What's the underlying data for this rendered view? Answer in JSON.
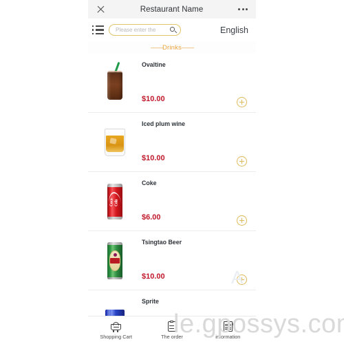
{
  "titlebar": {
    "close_icon": "close-icon",
    "title": "Restaurant Name",
    "more_icon": "more-options-icon"
  },
  "toolbar": {
    "menu_icon": "list-menu-icon",
    "search_placeholder": "Please enter the",
    "search_value": "",
    "search_icon": "search-icon",
    "language": "English"
  },
  "section": {
    "dash_left": "——",
    "label": "Drinks",
    "dash_right": "——",
    "accent_color": "#e8a33d"
  },
  "products": [
    {
      "name": "Ovaltine",
      "price": "$10.00",
      "art": "glass-tall",
      "add_label": "add-to-cart"
    },
    {
      "name": "Iced plum wine",
      "price": "$10.00",
      "art": "glass-short",
      "add_label": "add-to-cart"
    },
    {
      "name": "Coke",
      "price": "$6.00",
      "art": "can-coke",
      "add_label": "add-to-cart"
    },
    {
      "name": "Tsingtao Beer",
      "price": "$10.00",
      "art": "can-beer",
      "add_label": "add-to-cart"
    },
    {
      "name": "Sprite",
      "price": "",
      "art": "can-sprite",
      "add_label": "add-to-cart"
    }
  ],
  "bottom_nav": [
    {
      "label": "Shopping Cart",
      "icon": "shopping-cart-icon"
    },
    {
      "label": "The order",
      "icon": "order-document-icon"
    },
    {
      "label": "information",
      "icon": "information-document-icon"
    }
  ],
  "watermark": {
    "main": "le.gpossys.com",
    "secondary": "A"
  },
  "colors": {
    "price": "#c0182b",
    "accent_gold": "#e0ba5c",
    "titlebar_bg": "#f4f4f4"
  }
}
